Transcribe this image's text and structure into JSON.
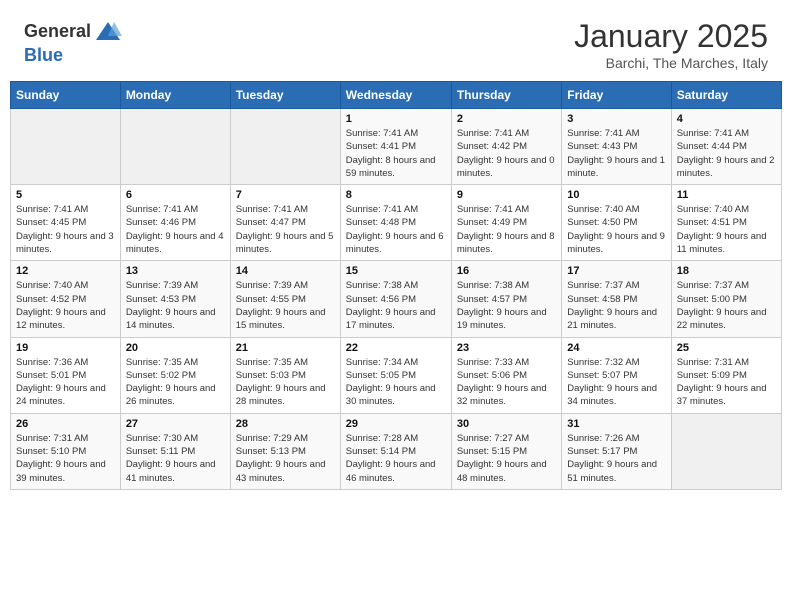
{
  "header": {
    "logo_general": "General",
    "logo_blue": "Blue",
    "month_title": "January 2025",
    "location": "Barchi, The Marches, Italy"
  },
  "days_of_week": [
    "Sunday",
    "Monday",
    "Tuesday",
    "Wednesday",
    "Thursday",
    "Friday",
    "Saturday"
  ],
  "weeks": [
    [
      {
        "day": "",
        "info": ""
      },
      {
        "day": "",
        "info": ""
      },
      {
        "day": "",
        "info": ""
      },
      {
        "day": "1",
        "info": "Sunrise: 7:41 AM\nSunset: 4:41 PM\nDaylight: 8 hours and 59 minutes."
      },
      {
        "day": "2",
        "info": "Sunrise: 7:41 AM\nSunset: 4:42 PM\nDaylight: 9 hours and 0 minutes."
      },
      {
        "day": "3",
        "info": "Sunrise: 7:41 AM\nSunset: 4:43 PM\nDaylight: 9 hours and 1 minute."
      },
      {
        "day": "4",
        "info": "Sunrise: 7:41 AM\nSunset: 4:44 PM\nDaylight: 9 hours and 2 minutes."
      }
    ],
    [
      {
        "day": "5",
        "info": "Sunrise: 7:41 AM\nSunset: 4:45 PM\nDaylight: 9 hours and 3 minutes."
      },
      {
        "day": "6",
        "info": "Sunrise: 7:41 AM\nSunset: 4:46 PM\nDaylight: 9 hours and 4 minutes."
      },
      {
        "day": "7",
        "info": "Sunrise: 7:41 AM\nSunset: 4:47 PM\nDaylight: 9 hours and 5 minutes."
      },
      {
        "day": "8",
        "info": "Sunrise: 7:41 AM\nSunset: 4:48 PM\nDaylight: 9 hours and 6 minutes."
      },
      {
        "day": "9",
        "info": "Sunrise: 7:41 AM\nSunset: 4:49 PM\nDaylight: 9 hours and 8 minutes."
      },
      {
        "day": "10",
        "info": "Sunrise: 7:40 AM\nSunset: 4:50 PM\nDaylight: 9 hours and 9 minutes."
      },
      {
        "day": "11",
        "info": "Sunrise: 7:40 AM\nSunset: 4:51 PM\nDaylight: 9 hours and 11 minutes."
      }
    ],
    [
      {
        "day": "12",
        "info": "Sunrise: 7:40 AM\nSunset: 4:52 PM\nDaylight: 9 hours and 12 minutes."
      },
      {
        "day": "13",
        "info": "Sunrise: 7:39 AM\nSunset: 4:53 PM\nDaylight: 9 hours and 14 minutes."
      },
      {
        "day": "14",
        "info": "Sunrise: 7:39 AM\nSunset: 4:55 PM\nDaylight: 9 hours and 15 minutes."
      },
      {
        "day": "15",
        "info": "Sunrise: 7:38 AM\nSunset: 4:56 PM\nDaylight: 9 hours and 17 minutes."
      },
      {
        "day": "16",
        "info": "Sunrise: 7:38 AM\nSunset: 4:57 PM\nDaylight: 9 hours and 19 minutes."
      },
      {
        "day": "17",
        "info": "Sunrise: 7:37 AM\nSunset: 4:58 PM\nDaylight: 9 hours and 21 minutes."
      },
      {
        "day": "18",
        "info": "Sunrise: 7:37 AM\nSunset: 5:00 PM\nDaylight: 9 hours and 22 minutes."
      }
    ],
    [
      {
        "day": "19",
        "info": "Sunrise: 7:36 AM\nSunset: 5:01 PM\nDaylight: 9 hours and 24 minutes."
      },
      {
        "day": "20",
        "info": "Sunrise: 7:35 AM\nSunset: 5:02 PM\nDaylight: 9 hours and 26 minutes."
      },
      {
        "day": "21",
        "info": "Sunrise: 7:35 AM\nSunset: 5:03 PM\nDaylight: 9 hours and 28 minutes."
      },
      {
        "day": "22",
        "info": "Sunrise: 7:34 AM\nSunset: 5:05 PM\nDaylight: 9 hours and 30 minutes."
      },
      {
        "day": "23",
        "info": "Sunrise: 7:33 AM\nSunset: 5:06 PM\nDaylight: 9 hours and 32 minutes."
      },
      {
        "day": "24",
        "info": "Sunrise: 7:32 AM\nSunset: 5:07 PM\nDaylight: 9 hours and 34 minutes."
      },
      {
        "day": "25",
        "info": "Sunrise: 7:31 AM\nSunset: 5:09 PM\nDaylight: 9 hours and 37 minutes."
      }
    ],
    [
      {
        "day": "26",
        "info": "Sunrise: 7:31 AM\nSunset: 5:10 PM\nDaylight: 9 hours and 39 minutes."
      },
      {
        "day": "27",
        "info": "Sunrise: 7:30 AM\nSunset: 5:11 PM\nDaylight: 9 hours and 41 minutes."
      },
      {
        "day": "28",
        "info": "Sunrise: 7:29 AM\nSunset: 5:13 PM\nDaylight: 9 hours and 43 minutes."
      },
      {
        "day": "29",
        "info": "Sunrise: 7:28 AM\nSunset: 5:14 PM\nDaylight: 9 hours and 46 minutes."
      },
      {
        "day": "30",
        "info": "Sunrise: 7:27 AM\nSunset: 5:15 PM\nDaylight: 9 hours and 48 minutes."
      },
      {
        "day": "31",
        "info": "Sunrise: 7:26 AM\nSunset: 5:17 PM\nDaylight: 9 hours and 51 minutes."
      },
      {
        "day": "",
        "info": ""
      }
    ]
  ]
}
